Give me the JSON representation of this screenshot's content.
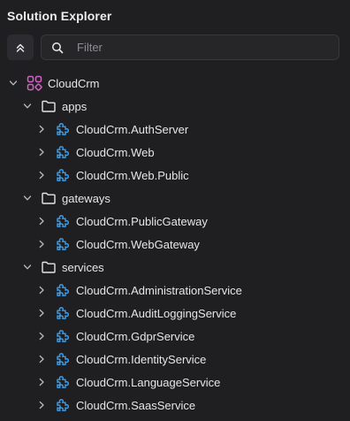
{
  "panel": {
    "title": "Solution Explorer",
    "collapse_icon": "chevrons-up-icon",
    "filter": {
      "placeholder": "Filter",
      "value": ""
    }
  },
  "colors": {
    "background": "#1f1f21",
    "solution_icon": "#d062c4",
    "project_icon": "#3aa0f0",
    "text": "#e6e6e8"
  },
  "tree": {
    "root": {
      "label": "CloudCrm",
      "icon": "solution-icon",
      "expanded": true
    },
    "folders": [
      {
        "label": "apps",
        "expanded": true,
        "projects": [
          "CloudCrm.AuthServer",
          "CloudCrm.Web",
          "CloudCrm.Web.Public"
        ]
      },
      {
        "label": "gateways",
        "expanded": true,
        "projects": [
          "CloudCrm.PublicGateway",
          "CloudCrm.WebGateway"
        ]
      },
      {
        "label": "services",
        "expanded": true,
        "projects": [
          "CloudCrm.AdministrationService",
          "CloudCrm.AuditLoggingService",
          "CloudCrm.GdprService",
          "CloudCrm.IdentityService",
          "CloudCrm.LanguageService",
          "CloudCrm.SaasService"
        ]
      }
    ]
  }
}
